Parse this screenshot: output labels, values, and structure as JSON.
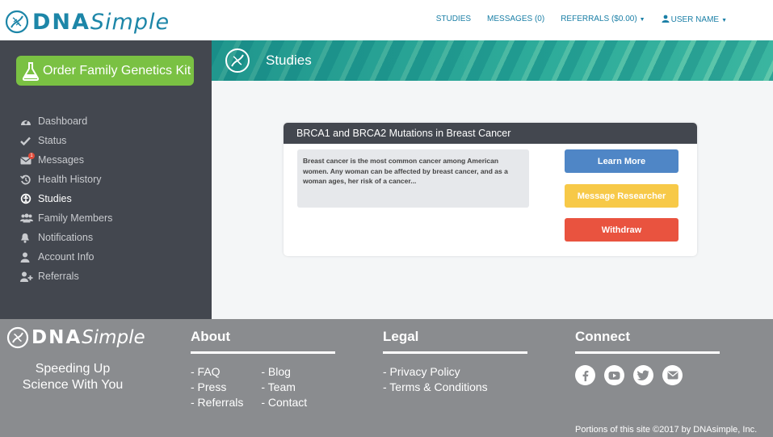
{
  "header": {
    "logo_dna": "DNA",
    "logo_simple": "Simple",
    "nav": {
      "studies": "STUDIES",
      "messages": "MESSAGES (0)",
      "referrals": "REFERRALS ($0.00)",
      "user": "USER NAME"
    }
  },
  "sidebar": {
    "order_button": "Order Family Genetics Kit",
    "messages_badge": "1",
    "items": [
      {
        "label": "Dashboard",
        "icon": "dashboard-icon"
      },
      {
        "label": "Status",
        "icon": "check-icon"
      },
      {
        "label": "Messages",
        "icon": "envelope-icon"
      },
      {
        "label": "Health History",
        "icon": "history-icon"
      },
      {
        "label": "Studies",
        "icon": "studies-icon"
      },
      {
        "label": "Family Members",
        "icon": "users-icon"
      },
      {
        "label": "Notifications",
        "icon": "bell-icon"
      },
      {
        "label": "Account Info",
        "icon": "user-icon"
      },
      {
        "label": "Referrals",
        "icon": "user-plus-icon"
      }
    ],
    "active": "Studies"
  },
  "banner": {
    "title": "Studies"
  },
  "study": {
    "title": "BRCA1 and BRCA2 Mutations in Breast Cancer",
    "description": "Breast cancer is the most common cancer among American women. Any woman can be affected by breast cancer, and as a woman ages, her risk of a cancer...",
    "buttons": {
      "learn_more": "Learn More",
      "message_researcher": "Message Researcher",
      "withdraw": "Withdraw"
    }
  },
  "footer": {
    "logo_dna": "DNA",
    "logo_simple": "Simple",
    "tagline_line1": "Speeding Up",
    "tagline_line2": "Science With You",
    "about": {
      "heading": "About",
      "col1": [
        "- FAQ",
        "- Press",
        "- Referrals"
      ],
      "col2": [
        "- Blog",
        "- Team",
        "- Contact"
      ]
    },
    "legal": {
      "heading": "Legal",
      "links": [
        "- Privacy Policy",
        "- Terms & Conditions"
      ]
    },
    "connect": {
      "heading": "Connect",
      "icons": [
        "facebook-icon",
        "youtube-icon",
        "twitter-icon",
        "email-icon"
      ]
    },
    "copyright": "Portions of this site ©2017 by DNAsimple, Inc."
  },
  "colors": {
    "brand_blue": "#1d86a8",
    "sidebar_bg": "#43474f",
    "order_green": "#7ac143",
    "learn_blue": "#4f86c6",
    "message_yellow": "#f7c948",
    "withdraw_red": "#e9533f",
    "footer_gray": "#8a8c8f"
  }
}
